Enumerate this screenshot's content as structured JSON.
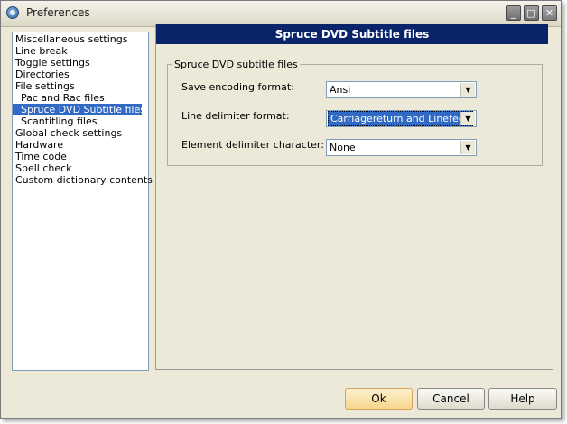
{
  "window": {
    "title": "Preferences"
  },
  "title_buttons": {
    "minimize": "_",
    "maximize": "□",
    "close": "✕"
  },
  "tree": {
    "items": [
      {
        "label": "Miscellaneous settings",
        "level": 0,
        "selected": false
      },
      {
        "label": "Line break",
        "level": 0,
        "selected": false
      },
      {
        "label": "Toggle settings",
        "level": 0,
        "selected": false
      },
      {
        "label": "Directories",
        "level": 0,
        "selected": false
      },
      {
        "label": "File settings",
        "level": 0,
        "selected": false
      },
      {
        "label": "Pac and Rac files",
        "level": 1,
        "selected": false
      },
      {
        "label": "Spruce DVD Subtitle files",
        "level": 1,
        "selected": true
      },
      {
        "label": "Scantitling files",
        "level": 1,
        "selected": false
      },
      {
        "label": "Global check settings",
        "level": 0,
        "selected": false
      },
      {
        "label": "Hardware",
        "level": 0,
        "selected": false
      },
      {
        "label": "Time code",
        "level": 0,
        "selected": false
      },
      {
        "label": "Spell check",
        "level": 0,
        "selected": false
      },
      {
        "label": "Custom dictionary contents",
        "level": 0,
        "selected": false
      }
    ]
  },
  "panel": {
    "header": "Spruce DVD Subtitle files",
    "group_title": "Spruce DVD subtitle files",
    "fields": {
      "save_encoding": {
        "label": "Save encoding format:",
        "value": "Ansi"
      },
      "line_delimiter": {
        "label": "Line delimiter format:",
        "value": "Carriagereturn and Linefeed"
      },
      "element_delimiter": {
        "label": "Element delimiter character:",
        "value": "None"
      }
    }
  },
  "buttons": {
    "ok": "Ok",
    "cancel": "Cancel",
    "help": "Help"
  },
  "colors": {
    "selection": "#316ac5",
    "header": "#0a246a",
    "ok_button": "#f6d68c"
  },
  "icons": {
    "app": "preferences-gear-icon",
    "dropdown": "chevron-down-icon"
  }
}
